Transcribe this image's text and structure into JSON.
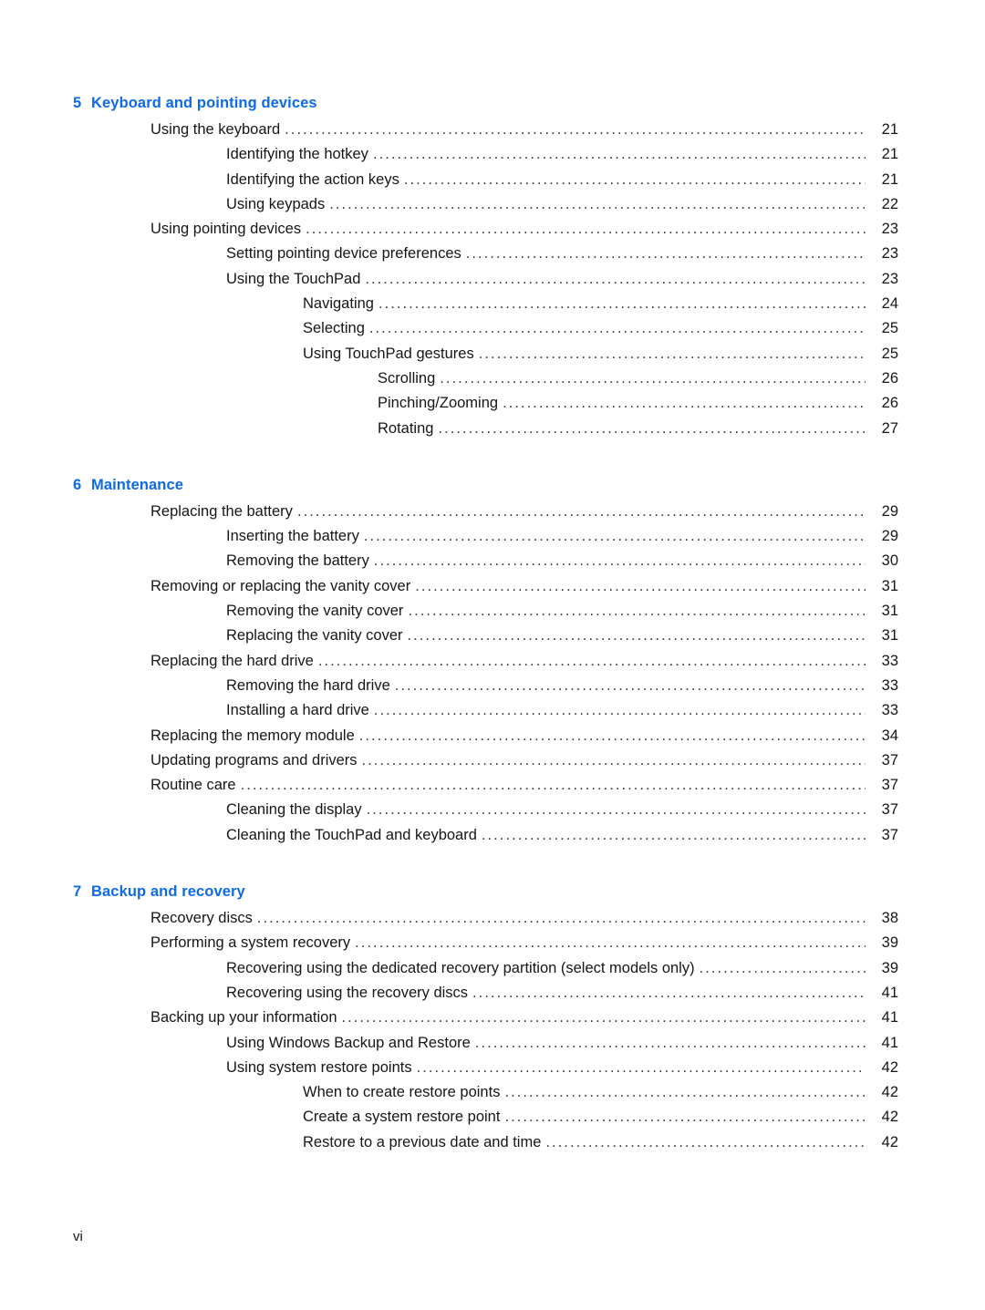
{
  "document": {
    "type": "table-of-contents",
    "footer_page_label": "vi",
    "heading_color": "#0d6ae8",
    "text_color": "#161616"
  },
  "sections": [
    {
      "number": "5",
      "title": "Keyboard and pointing devices",
      "entries": [
        {
          "label": "Using the keyboard",
          "page": "21",
          "level": 1
        },
        {
          "label": "Identifying the hotkey",
          "page": "21",
          "level": 2
        },
        {
          "label": "Identifying the action keys",
          "page": "21",
          "level": 2
        },
        {
          "label": "Using keypads",
          "page": "22",
          "level": 2
        },
        {
          "label": "Using pointing devices",
          "page": "23",
          "level": 1
        },
        {
          "label": "Setting pointing device preferences",
          "page": "23",
          "level": 2
        },
        {
          "label": "Using the TouchPad",
          "page": "23",
          "level": 2
        },
        {
          "label": "Navigating",
          "page": "24",
          "level": 3
        },
        {
          "label": "Selecting",
          "page": "25",
          "level": 3
        },
        {
          "label": "Using TouchPad gestures",
          "page": "25",
          "level": 3
        },
        {
          "label": "Scrolling",
          "page": "26",
          "level": 4
        },
        {
          "label": "Pinching/Zooming",
          "page": "26",
          "level": 4
        },
        {
          "label": "Rotating",
          "page": "27",
          "level": 4
        }
      ]
    },
    {
      "number": "6",
      "title": "Maintenance",
      "entries": [
        {
          "label": "Replacing the battery",
          "page": "29",
          "level": 1
        },
        {
          "label": "Inserting the battery",
          "page": "29",
          "level": 2
        },
        {
          "label": "Removing the battery",
          "page": "30",
          "level": 2
        },
        {
          "label": "Removing or replacing the vanity cover",
          "page": "31",
          "level": 1
        },
        {
          "label": "Removing the vanity cover",
          "page": "31",
          "level": 2
        },
        {
          "label": "Replacing the vanity cover",
          "page": "31",
          "level": 2
        },
        {
          "label": "Replacing the hard drive",
          "page": "33",
          "level": 1
        },
        {
          "label": "Removing the hard drive",
          "page": "33",
          "level": 2
        },
        {
          "label": "Installing a hard drive",
          "page": "33",
          "level": 2
        },
        {
          "label": "Replacing the memory module",
          "page": "34",
          "level": 1
        },
        {
          "label": "Updating programs and drivers",
          "page": "37",
          "level": 1
        },
        {
          "label": "Routine care",
          "page": "37",
          "level": 1
        },
        {
          "label": "Cleaning the display",
          "page": "37",
          "level": 2
        },
        {
          "label": "Cleaning the TouchPad and keyboard",
          "page": "37",
          "level": 2
        }
      ]
    },
    {
      "number": "7",
      "title": "Backup and recovery",
      "entries": [
        {
          "label": "Recovery discs",
          "page": "38",
          "level": 1
        },
        {
          "label": "Performing a system recovery",
          "page": "39",
          "level": 1
        },
        {
          "label": "Recovering using the dedicated recovery partition (select models only)",
          "page": "39",
          "level": 2
        },
        {
          "label": "Recovering using the recovery discs",
          "page": "41",
          "level": 2
        },
        {
          "label": "Backing up your information",
          "page": "41",
          "level": 1
        },
        {
          "label": "Using Windows Backup and Restore",
          "page": "41",
          "level": 2
        },
        {
          "label": "Using system restore points",
          "page": "42",
          "level": 2
        },
        {
          "label": "When to create restore points",
          "page": "42",
          "level": 3
        },
        {
          "label": "Create a system restore point",
          "page": "42",
          "level": 3
        },
        {
          "label": "Restore to a previous date and time",
          "page": "42",
          "level": 3
        }
      ]
    }
  ]
}
